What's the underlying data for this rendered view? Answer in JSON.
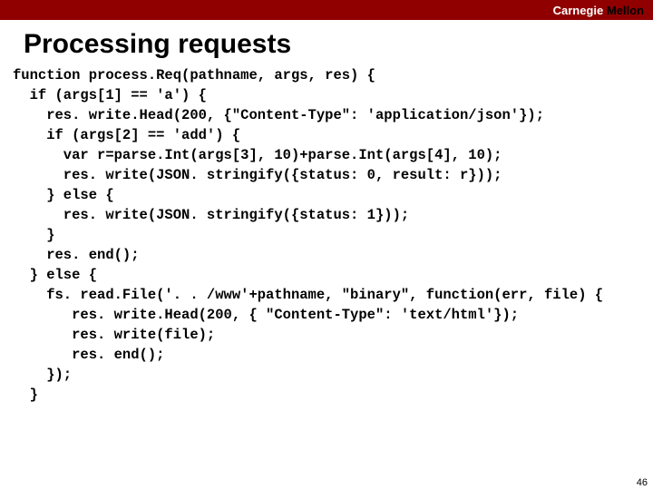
{
  "header": {
    "text_white": "Carnegie ",
    "text_black": "Mellon"
  },
  "title": "Processing requests",
  "code": "function process.Req(pathname, args, res) {\n  if (args[1] == 'a') {\n    res. write.Head(200, {\"Content-Type\": 'application/json'});\n    if (args[2] == 'add') {\n      var r=parse.Int(args[3], 10)+parse.Int(args[4], 10);\n      res. write(JSON. stringify({status: 0, result: r}));\n    } else {\n      res. write(JSON. stringify({status: 1}));\n    }\n    res. end();\n  } else {\n    fs. read.File('. . /www'+pathname, \"binary\", function(err, file) {\n       res. write.Head(200, { \"Content-Type\": 'text/html'});\n       res. write(file);\n       res. end();\n    });\n  }",
  "slide_number": "46"
}
